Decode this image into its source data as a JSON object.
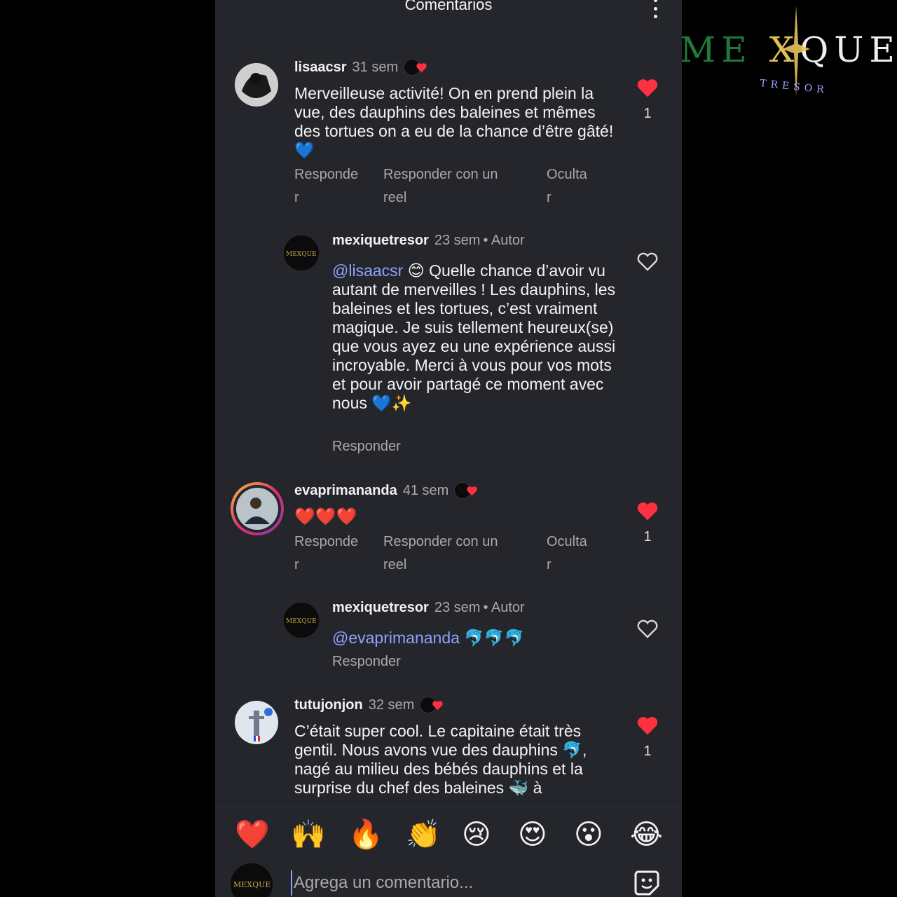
{
  "header": {
    "title": "Comentarios"
  },
  "logo": {
    "text_left": "ME",
    "text_x": "X",
    "text_right": "QUE",
    "subtitle": "TRESOR"
  },
  "comments": [
    {
      "username": "lisaacsr",
      "time": "31 sem",
      "text": "Merveilleuse activité! On en prend plein la vue, des dauphins des baleines et mêmes des tortues on a eu de la chance d’être gâté!💙",
      "actions": {
        "reply_a": "Responde",
        "reply_b": "r",
        "reel_a": "Responder con un",
        "reel_b": "reel",
        "hide_a": "Oculta",
        "hide_b": "r"
      },
      "like_count": "1"
    },
    {
      "username": "evaprimananda",
      "time": "41 sem",
      "text": "❤️❤️❤️",
      "actions": {
        "reply_a": "Responde",
        "reply_b": "r",
        "reel_a": "Responder con un",
        "reel_b": "reel",
        "hide_a": "Oculta",
        "hide_b": "r"
      },
      "like_count": "1"
    },
    {
      "username": "tutujonjon",
      "time": "32 sem",
      "text": "C’était super cool. Le capitaine était très gentil. Nous avons vue des dauphins 🐬, nagé au milieu des bébés dauphins et la surprise du chef des baleines 🐳 à",
      "like_count": "1"
    }
  ],
  "replies": [
    {
      "username": "mexiquetresor",
      "time": "23 sem",
      "author": "• Autor",
      "mention": "@lisaacsr",
      "text": " 😊 Quelle chance d’avoir vu autant de merveilles ! Les dauphins, les baleines et les tortues, c’est vraiment magique. Je suis tellement heureux(se) que vous ayez eu une expérience aussi incroyable. Merci à vous pour vos mots et pour avoir partagé ce moment avec nous 💙✨",
      "reply": "Responder"
    },
    {
      "username": "mexiquetresor",
      "time": "23 sem",
      "author": "• Autor",
      "mention": "@evaprimananda",
      "text": " 🐬🐬🐬",
      "reply": "Responder"
    }
  ],
  "emoji_bar": [
    "❤️",
    "🙌",
    "🔥",
    "👏",
    "😢",
    "😍",
    "😮",
    "😂"
  ],
  "input": {
    "placeholder": "Agrega un comentario..."
  },
  "colors": {
    "panel": "#25262b",
    "like_red": "#ff3040",
    "mention": "#8da2ff",
    "muted": "#a8a8ad"
  }
}
